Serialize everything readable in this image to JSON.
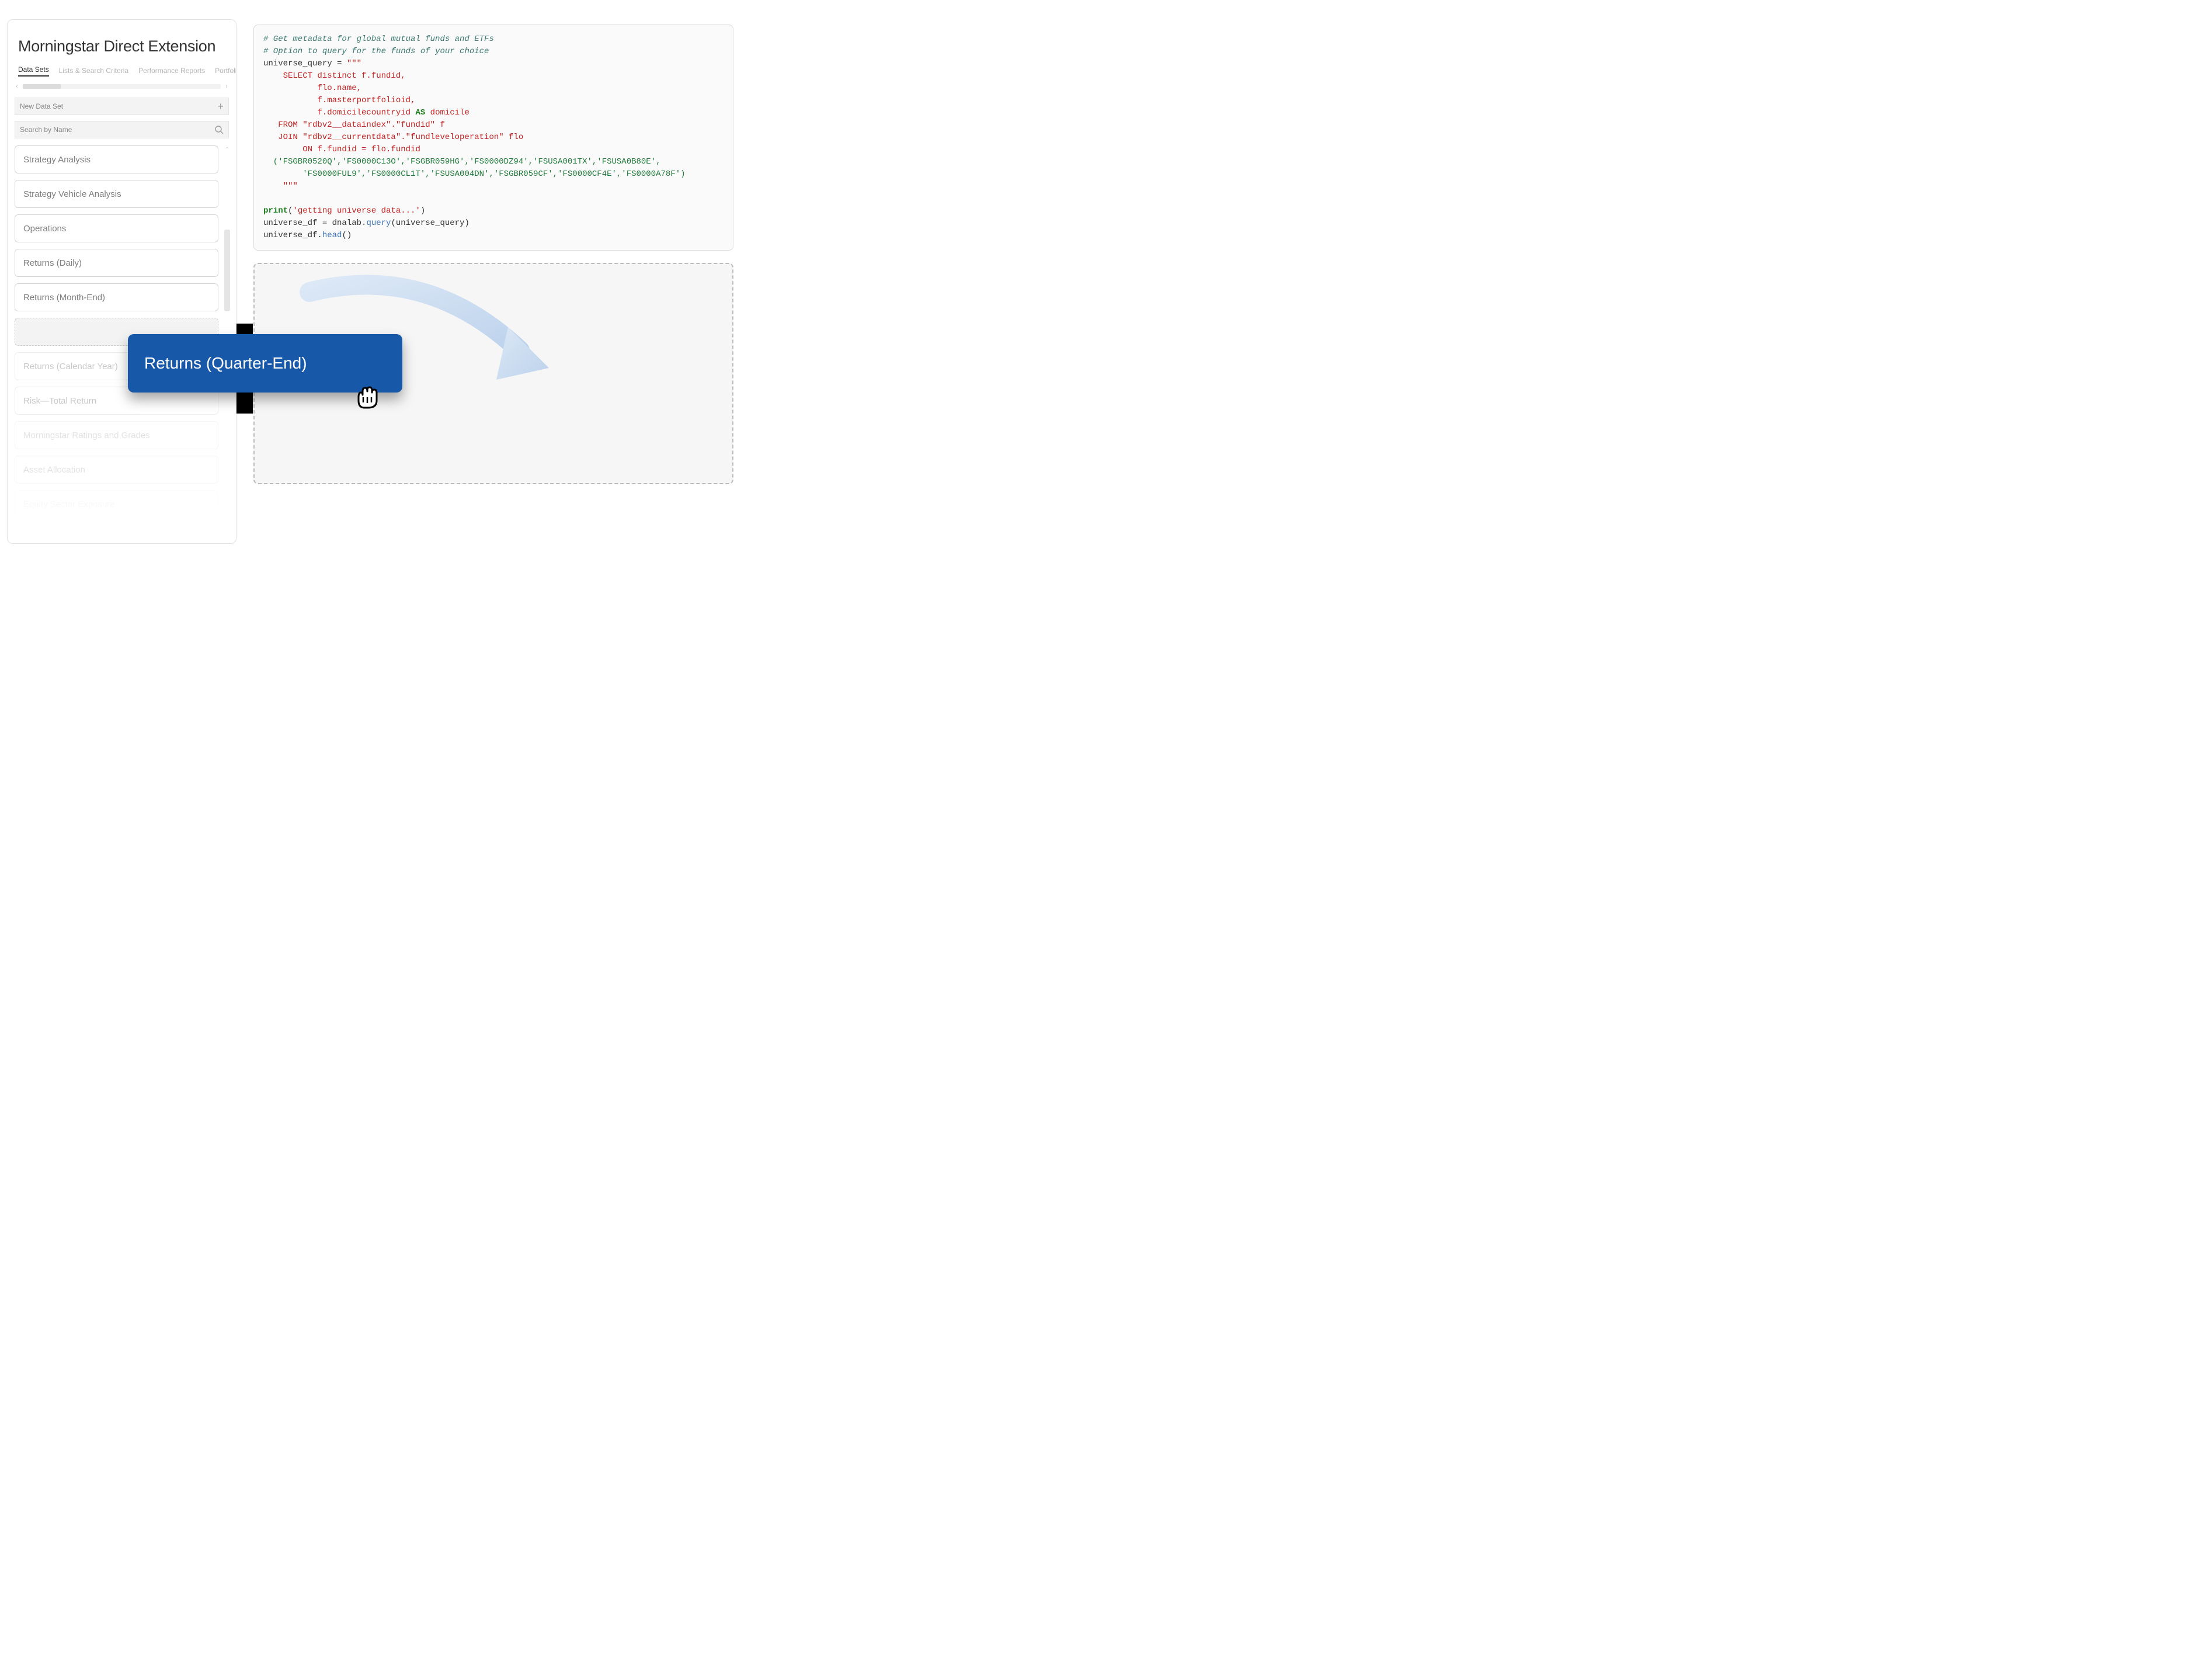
{
  "sidebar": {
    "title": "Morningstar Direct Extension",
    "tabs": [
      "Data Sets",
      "Lists & Search Criteria",
      "Performance Reports",
      "Portfolio M"
    ],
    "active_tab_index": 0,
    "new_dataset_label": "New Data Set",
    "search_placeholder": "Search by Name",
    "items": [
      "Strategy Analysis",
      "Strategy Vehicle Analysis",
      "Operations",
      "Returns (Daily)",
      "Returns (Month-End)",
      "",
      "Returns (Calendar Year)",
      "Risk—Total Return",
      "Morningstar Ratings and Grades",
      "Asset Allocation",
      "Equity Sector Exposure"
    ]
  },
  "drag": {
    "label": "Returns (Quarter-End)"
  },
  "code": {
    "comment1": "# Get metadata for global mutual funds and ETFs",
    "comment2": "# Option to query for the funds of your choice",
    "assign": "universe_query = ",
    "triq": "\"\"\"",
    "l_select": "    SELECT distinct f.fundid,",
    "l_flo": "           flo.name,",
    "l_master": "           f.masterportfolioid,",
    "l_dom_pre": "           f.domicilecountryid ",
    "l_dom_as": "AS",
    "l_dom_post": " domicile",
    "l_from": "   FROM \"rdbv2__dataindex\".\"fundid\" f",
    "l_join": "   JOIN \"rdbv2__currentdata\".\"fundleveloperation\" flo",
    "l_on": "        ON f.fundid = flo.fundid",
    "l_ids1": "  ('FSGBR0520Q','FS0000C13O','FSGBR059HG','FS0000DZ94','FSUSA001TX','FSUSA0B80E',",
    "l_ids2": "        'FS0000FUL9','FS0000CL1T','FSUSA004DN','FSGBR059CF','FS0000CF4E','FS0000A78F')",
    "l_close": "    \"\"\"",
    "print_kw": "print",
    "print_arg": "'getting universe data...'",
    "df_line": "universe_df = dnalab.",
    "query_fn": "query",
    "query_arg": "(universe_query)",
    "head_line": "universe_df.",
    "head_fn": "head",
    "head_arg": "()"
  }
}
